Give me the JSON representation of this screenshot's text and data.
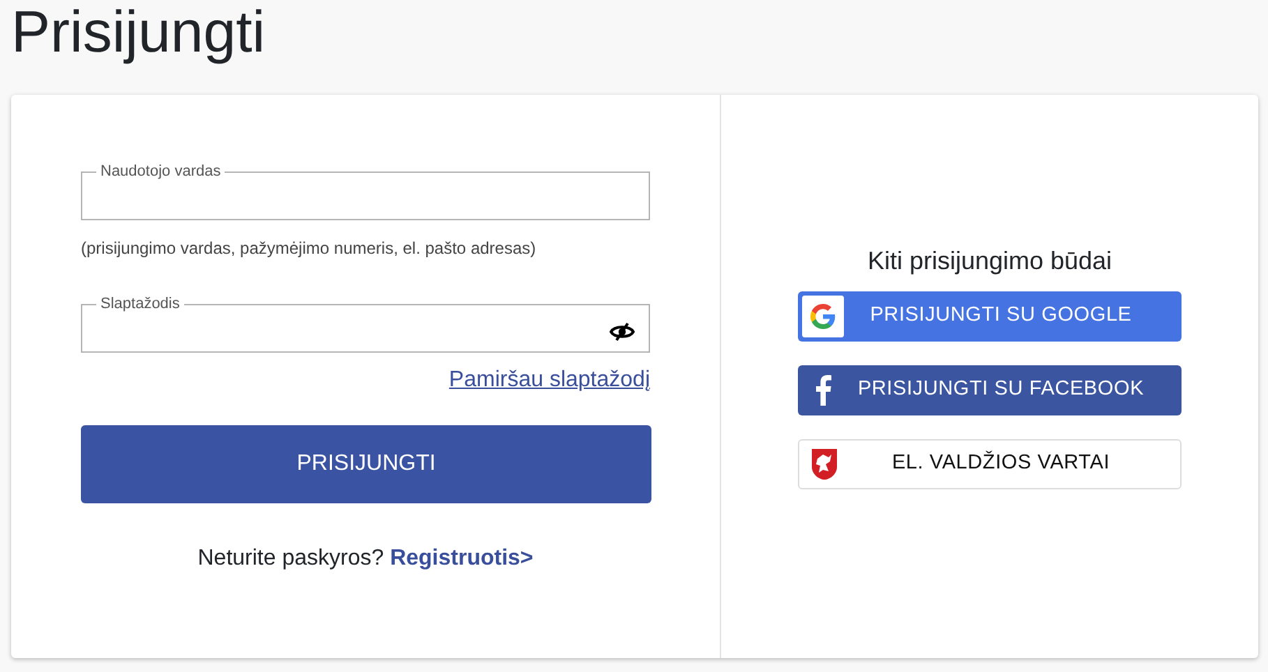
{
  "title": "Prisijungti",
  "login_form": {
    "username": {
      "label": "Naudotojo vardas",
      "hint": "(prisijungimo vardas, pažymėjimo numeris, el. pašto adresas)"
    },
    "password": {
      "label": "Slaptažodis"
    },
    "forgot_link": "Pamiršau slaptažodį",
    "submit": "PRISIJUNGTI",
    "register_prompt": "Neturite paskyros?",
    "register_link": "Registruotis>"
  },
  "other_methods": {
    "heading": "Kiti prisijungimo būdai",
    "buttons": [
      {
        "kind": "google",
        "label": "PRISIJUNGTI SU GOOGLE"
      },
      {
        "kind": "facebook",
        "label": "PRISIJUNGTI SU FACEBOOK"
      },
      {
        "kind": "gov",
        "label": "EL. VALDŽIOS VARTAI"
      }
    ]
  }
}
